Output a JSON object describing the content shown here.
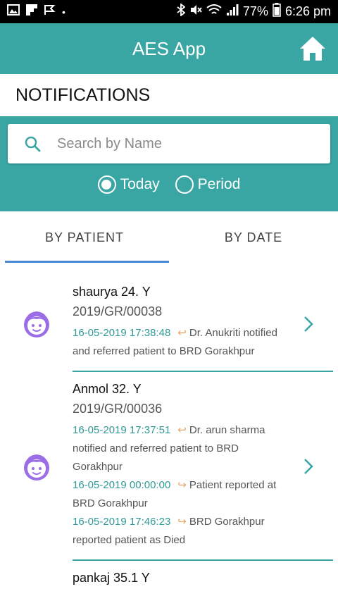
{
  "status_bar": {
    "battery": "77%",
    "time": "6:26 pm"
  },
  "app_bar": {
    "title": "AES App",
    "home_icon": "home-icon"
  },
  "page": {
    "title": "NOTIFICATIONS"
  },
  "search": {
    "placeholder": "Search by Name",
    "value": ""
  },
  "period_filter": {
    "options": [
      "Today",
      "Period"
    ],
    "selected": "Today"
  },
  "tabs": [
    {
      "label": "BY PATIENT",
      "active": true
    },
    {
      "label": "BY DATE",
      "active": false
    }
  ],
  "patients": [
    {
      "name": "shaurya 24. Y",
      "reg_no": "2019/GR/00038",
      "events": [
        {
          "timestamp": "16-05-2019 17:38:48",
          "actor": "Dr. Anukriti",
          "text": "notified and referred patient to BRD Gorakhpur"
        }
      ]
    },
    {
      "name": "Anmol 32. Y",
      "reg_no": "2019/GR/00036",
      "events": [
        {
          "timestamp": "16-05-2019 17:37:51",
          "actor": "Dr. arun sharma",
          "text": "notified and referred patient to BRD Gorakhpur"
        },
        {
          "timestamp": "16-05-2019 00:00:00",
          "actor": "Patient",
          "text": "reported at BRD Gorakhpur"
        },
        {
          "timestamp": "16-05-2019 17:46:23",
          "actor": "BRD Gorakhpur",
          "text": "reported patient as Died"
        }
      ]
    },
    {
      "name": "pankaj 35.1 Y",
      "reg_no": "",
      "events": []
    }
  ],
  "colors": {
    "primary": "#3aa6a4",
    "tab_indicator": "#4b86d1",
    "avatar": "#9b6ee8",
    "timestamp": "#2f9a98"
  }
}
